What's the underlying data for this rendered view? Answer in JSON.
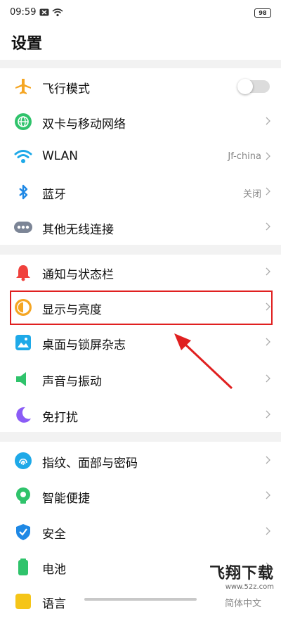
{
  "status_bar": {
    "time": "09:59",
    "battery": "98"
  },
  "page_title": "设置",
  "sections": [
    {
      "rows": [
        {
          "label": "飞行模式",
          "icon": "airplane-icon",
          "toggle": false
        },
        {
          "label": "双卡与移动网络",
          "icon": "globe-icon"
        },
        {
          "label": "WLAN",
          "icon": "wifi-icon",
          "value": "Jf-china"
        },
        {
          "label": "蓝牙",
          "icon": "bluetooth-icon",
          "value": "关闭"
        },
        {
          "label": "其他无线连接",
          "icon": "more-dots-icon"
        }
      ]
    },
    {
      "rows": [
        {
          "label": "通知与状态栏",
          "icon": "bell-icon"
        },
        {
          "label": "显示与亮度",
          "icon": "brightness-icon"
        },
        {
          "label": "桌面与锁屏杂志",
          "icon": "wallpaper-icon"
        },
        {
          "label": "声音与振动",
          "icon": "speaker-icon"
        },
        {
          "label": "免打扰",
          "icon": "moon-icon"
        }
      ]
    },
    {
      "rows": [
        {
          "label": "指纹、面部与密码",
          "icon": "fingerprint-icon"
        },
        {
          "label": "智能便捷",
          "icon": "smart-assist-icon"
        },
        {
          "label": "安全",
          "icon": "shield-icon"
        },
        {
          "label": "电池",
          "icon": "battery-icon"
        },
        {
          "label": "语言",
          "icon": "language-icon",
          "value": "简体中文"
        }
      ]
    }
  ],
  "watermark": {
    "main": "飞翔下载",
    "sub": "www.52z.com"
  },
  "colors": {
    "highlight": "#e02020",
    "separator": "#f2f2f2"
  }
}
